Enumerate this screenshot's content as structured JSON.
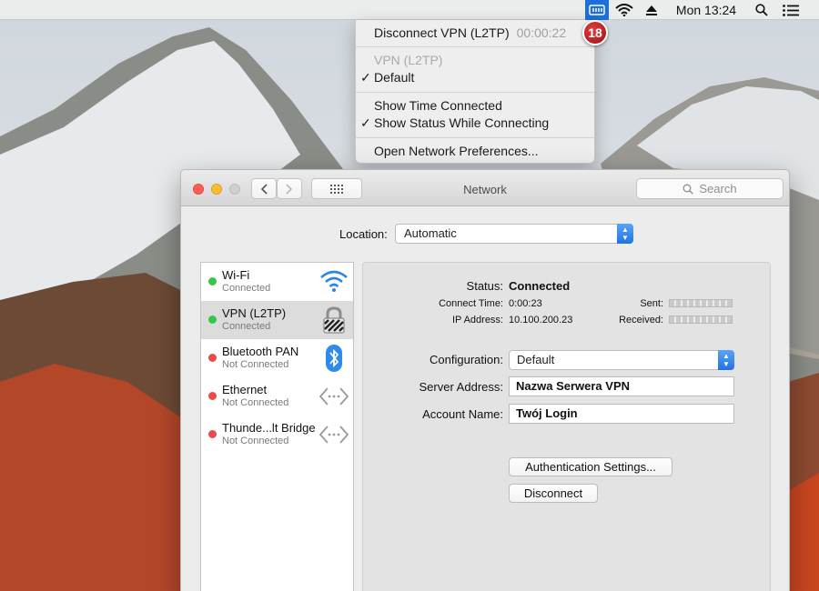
{
  "menubar": {
    "clock": "Mon 13:24",
    "icons": [
      "vpn-status-icon",
      "wifi-icon",
      "eject-icon",
      "spotlight-search-icon",
      "notification-center-icon"
    ]
  },
  "vpn_menu": {
    "disconnect_label": "Disconnect VPN (L2TP)",
    "timer": "00:00:22",
    "section_header": "VPN (L2TP)",
    "default_config": "Default",
    "show_time": "Show Time Connected",
    "show_status": "Show Status While Connecting",
    "open_prefs": "Open Network Preferences...",
    "badge": "18"
  },
  "window": {
    "title": "Network",
    "search_placeholder": "Search"
  },
  "location": {
    "label": "Location:",
    "value": "Automatic"
  },
  "services": [
    {
      "name": "Wi-Fi",
      "status": "Connected",
      "state": "green",
      "icon": "wifi-icon"
    },
    {
      "name": "VPN (L2TP)",
      "status": "Connected",
      "state": "green",
      "icon": "vpn-lock-icon"
    },
    {
      "name": "Bluetooth PAN",
      "status": "Not Connected",
      "state": "red",
      "icon": "bluetooth-icon"
    },
    {
      "name": "Ethernet",
      "status": "Not Connected",
      "state": "red",
      "icon": "ethernet-icon"
    },
    {
      "name": "Thunde...lt Bridge",
      "status": "Not Connected",
      "state": "red",
      "icon": "thunderbolt-bridge-icon"
    }
  ],
  "detail": {
    "status_label": "Status:",
    "status_value": "Connected",
    "connect_time_label": "Connect Time:",
    "connect_time_value": "0:00:23",
    "ip_label": "IP Address:",
    "ip_value": "10.100.200.23",
    "sent_label": "Sent:",
    "received_label": "Received:",
    "configuration_label": "Configuration:",
    "configuration_value": "Default",
    "server_label": "Server Address:",
    "server_value": "Nazwa Serwera VPN",
    "account_label": "Account Name:",
    "account_value": "Twój Login",
    "auth_button": "Authentication Settings...",
    "disconnect_button": "Disconnect"
  },
  "colors": {
    "connected": "#34c84a",
    "not_connected": "#ec4a45",
    "accent": "#1f73e5",
    "badge": "#c81e1e"
  }
}
